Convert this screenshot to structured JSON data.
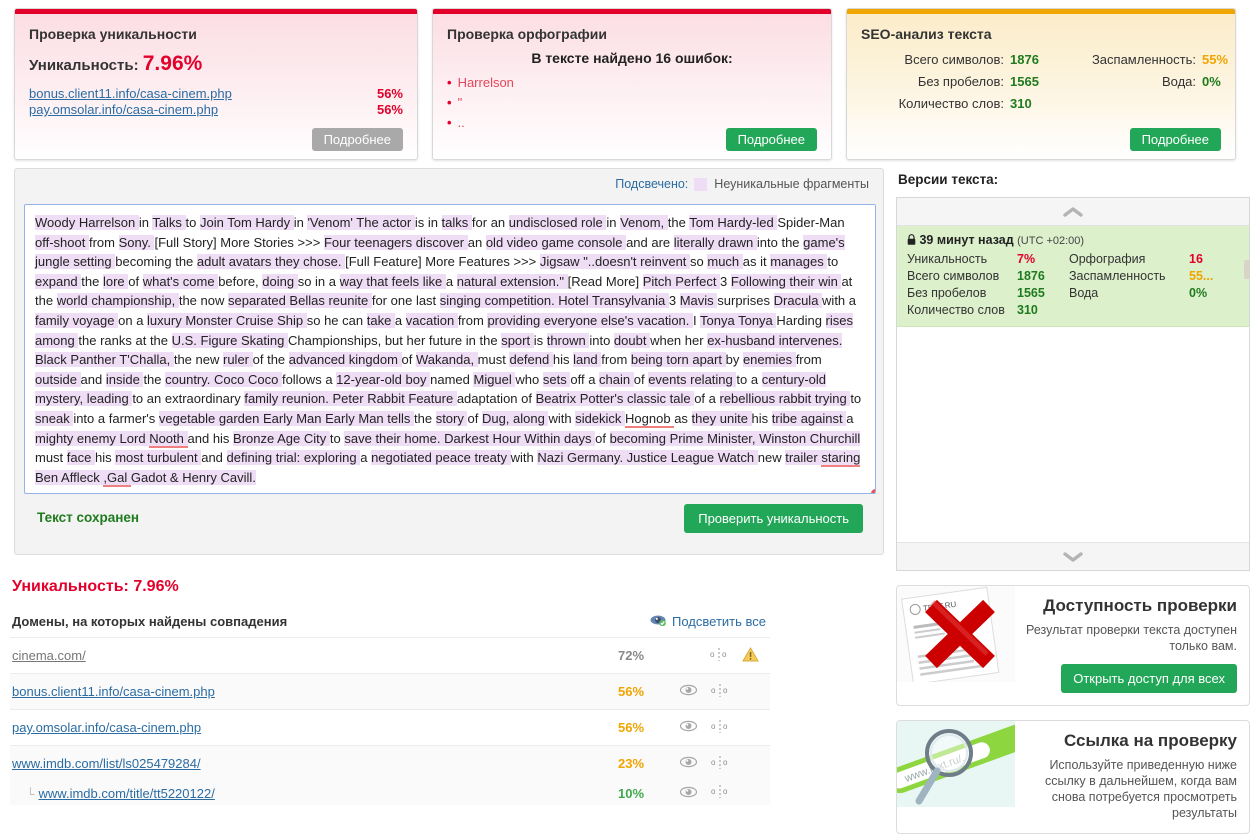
{
  "cards": {
    "uniqueness": {
      "title": "Проверка уникальности",
      "label": "Уникальность:",
      "value": "7.96%",
      "domains": [
        {
          "url": "bonus.client11.info/casa-cinem.php",
          "pct": "56%"
        },
        {
          "url": "pay.omsolar.info/casa-cinem.php",
          "pct": "56%"
        }
      ],
      "more_label": "Подробнее",
      "stripe_color": "#e3002b"
    },
    "spelling": {
      "title": "Проверка орфографии",
      "found_label": "В тексте найдено 16 ошибок:",
      "errors": [
        "Harrelson",
        "\"",
        ".."
      ],
      "more_label": "Подробнее",
      "stripe_color": "#e3002b"
    },
    "seo": {
      "title": "SEO-анализ текста",
      "stats": [
        {
          "label": "Всего символов:",
          "value": "1876",
          "tone": "green"
        },
        {
          "label": "Заспамленность:",
          "value": "55%",
          "tone": "orange"
        },
        {
          "label": "Без пробелов:",
          "value": "1565",
          "tone": "green"
        },
        {
          "label": "Вода:",
          "value": "0%",
          "tone": "green"
        },
        {
          "label": "Количество слов:",
          "value": "310",
          "tone": "green"
        }
      ],
      "more_label": "Подробнее",
      "stripe_color": "#f0a500"
    }
  },
  "editor": {
    "legend_prefix": "Подсвечено:",
    "legend_label": "Неуникальные фрагменты",
    "highlight_color": "#efddf5",
    "saved_message": "Текст сохранен",
    "check_button": "Проверить уникальность",
    "text": "Woody Harrelson in Talks to Join Tom Hardy in 'Venom' The actor is in talks for an undisclosed role in Venom, the Tom Hardy-led Spider-Man off-shoot from Sony. [Full Story] More Stories >>> Four teenagers discover an old video game console and are literally drawn into the game's jungle setting becoming the adult avatars they chose. [Full Feature] More Features >>> Jigsaw \"..doesn't reinvent so much as it manages to expand the lore of what's come before, doing so in a way that feels like a natural extension.\" [Read More] Pitch Perfect 3 Following their win at the world championship, the now separated Bellas reunite for one last singing competition. Hotel Transylvania 3 Mavis surprises Dracula with a family voyage on a luxury Monster Cruise Ship so he can take a vacation from providing everyone else's vacation. I Tonya Tonya Harding rises among the ranks at the U.S. Figure Skating Championships, but her future in the sport is thrown into doubt when her ex-husband intervenes. Black Panther T'Challa, the new ruler of the advanced kingdom of Wakanda, must defend his land from being torn apart by enemies from outside and inside the country. Coco Coco follows a 12-year-old boy named Miguel who sets off a chain of events relating to a century-old mystery, leading to an extraordinary family reunion. Peter Rabbit Feature adaptation of Beatrix Potter's classic tale of a rebellious rabbit trying to sneak into a farmer's vegetable garden Early Man Early Man tells the story of Dug, along with sidekick Hognob as they unite his tribe against a mighty enemy Lord Nooth and his Bronze Age City to save their home. Darkest Hour Within days of becoming Prime Minister, Winston Churchill must face his most turbulent and defining trial: exploring a negotiated peace treaty with Nazi Germany. Justice League Watch new trailer staring Ben Affleck ,Gal Gadot & Henry Cavill."
  },
  "results": {
    "title": "Уникальность: 7.96%",
    "columns_label": "Домены, на которых найдены совпадения",
    "highlight_all": "Подсветить все",
    "rows": [
      {
        "url": "cinema.com/",
        "pct": "72%",
        "tone": "grey",
        "eye": false,
        "warn": true,
        "sub": false
      },
      {
        "url": "bonus.client11.info/casa-cinem.php",
        "pct": "56%",
        "tone": "orange",
        "eye": true,
        "warn": false,
        "sub": false
      },
      {
        "url": "pay.omsolar.info/casa-cinem.php",
        "pct": "56%",
        "tone": "orange",
        "eye": true,
        "warn": false,
        "sub": false
      },
      {
        "url": "www.imdb.com/list/ls025479284/",
        "pct": "23%",
        "tone": "orange",
        "eye": true,
        "warn": false,
        "sub": false
      },
      {
        "url": "www.imdb.com/title/tt5220122/",
        "pct": "10%",
        "tone": "green",
        "eye": true,
        "warn": false,
        "sub": true
      }
    ]
  },
  "versions": {
    "title": "Версии текста:",
    "item": {
      "when": "39 минут назад",
      "utc": "(UTC +02:00)",
      "stats": [
        {
          "label": "Уникальность",
          "value": "7%",
          "tone": "red"
        },
        {
          "label": "Орфография",
          "value": "16",
          "tone": "red"
        },
        {
          "label": "Всего символов",
          "value": "1876",
          "tone": "green"
        },
        {
          "label": "Заспамленность",
          "value": "55...",
          "tone": "orange"
        },
        {
          "label": "Без пробелов",
          "value": "1565",
          "tone": "green"
        },
        {
          "label": "Вода",
          "value": "0%",
          "tone": "green"
        },
        {
          "label": "Количество слов",
          "value": "310",
          "tone": "green"
        }
      ],
      "close_label": "×"
    }
  },
  "promos": [
    {
      "heading": "Доступность проверки",
      "text": "Результат проверки текста доступен только вам.",
      "button": "Открыть доступ для всех",
      "image": "document-with-red-cross"
    },
    {
      "heading": "Ссылка на проверку",
      "text": "Используйте приведенную ниже ссылку в дальнейшем, когда вам снова потребуется просмотреть результаты",
      "button": "",
      "image": "magnifier-over-url-bar"
    }
  ]
}
